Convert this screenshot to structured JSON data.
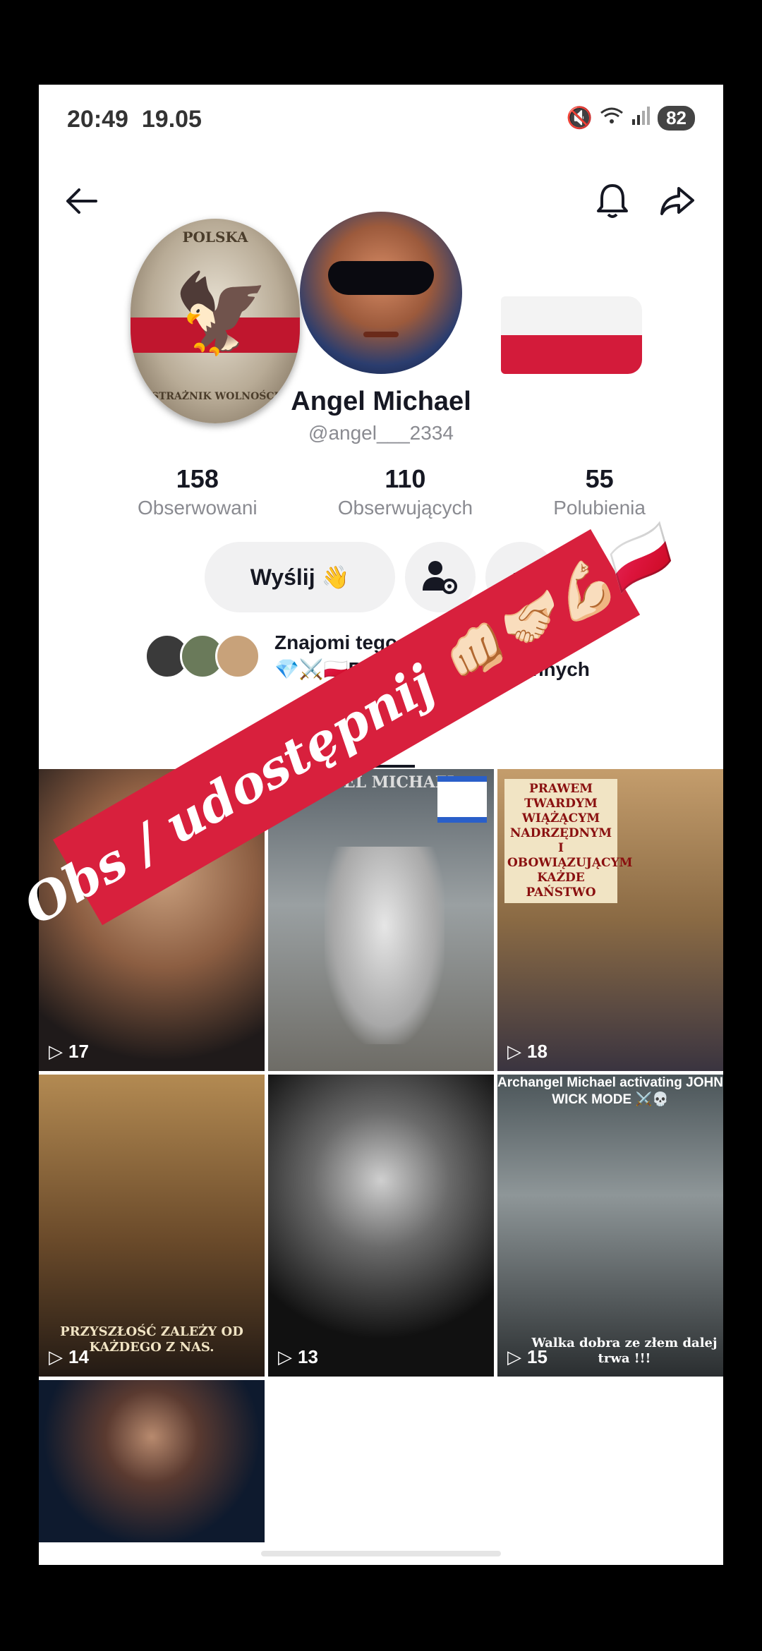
{
  "status_bar": {
    "time": "20:49",
    "date": "19.05",
    "battery": "82"
  },
  "profile": {
    "name": "Angel Michael",
    "handle": "@angel___2334",
    "badge_top_text": "POLSKA",
    "badge_bottom_text": "STRAŻNIK WOLNOŚCI"
  },
  "stats": [
    {
      "value": "158",
      "label": "Obserwowani"
    },
    {
      "value": "110",
      "label": "Obserwujących"
    },
    {
      "value": "55",
      "label": "Polubienia"
    }
  ],
  "actions": {
    "message_label": "Wyślij 👋"
  },
  "friends": {
    "line1": "Znajomi tego użytkownika to",
    "line2": "💎⚔️🇵🇱RAF..., Jolanta i 11 innych"
  },
  "videos": [
    {
      "count": "17",
      "caption": ""
    },
    {
      "count": "",
      "caption": "ANGEL MICHAEL"
    },
    {
      "count": "18",
      "caption": "PRAWEM TWARDYM WIĄŻĄCYM NADRZĘDNYM I OBOWIĄZUJĄCYM KAŻDE PAŃSTWO"
    },
    {
      "count": "14",
      "caption": "PRZYSZŁOŚĆ ZALEŻY OD KAŻDEGO Z NAS."
    },
    {
      "count": "13",
      "caption": ""
    },
    {
      "count": "15",
      "caption": "Archangel Michael activating JOHN WICK MODE ⚔️💀",
      "caption2": "Walka dobra ze złem dalej trwa !!!"
    },
    {
      "count": "",
      "caption": ""
    }
  ],
  "overlay_banner": "Obs / udostępnij 👊🏻🤝🏻💪🏻🇵🇱",
  "colors": {
    "accent_red": "#d8203d",
    "text": "#161823",
    "muted": "#8a8b91"
  }
}
